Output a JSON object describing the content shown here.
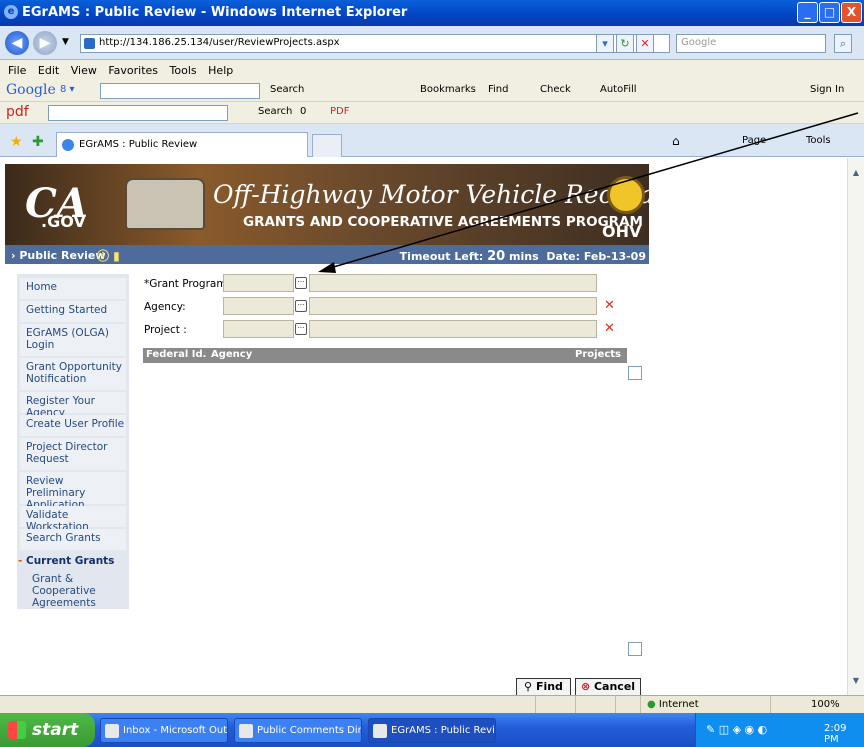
{
  "window": {
    "title": "EGrAMS : Public Review - Windows Internet Explorer",
    "buttons": [
      "_",
      "□",
      "X"
    ]
  },
  "address_bar": {
    "url": "http://134.186.25.134/user/ReviewProjects.aspx",
    "search_placeholder": "Google"
  },
  "menu": [
    "File",
    "Edit",
    "View",
    "Favorites",
    "Tools",
    "Help"
  ],
  "google_toolbar": {
    "logo": "Google",
    "g_label": "8 ▾",
    "search": "Search",
    "bookmarks": "Bookmarks",
    "find": "Find",
    "check": "Check",
    "autofill": "AutoFill",
    "signin": "Sign In"
  },
  "pdf_toolbar": {
    "logo": "pdf",
    "search": "Search",
    "count": "0",
    "pdf_label": "PDF"
  },
  "tab": {
    "title": "EGrAMS : Public Review",
    "page": "Page",
    "tools": "Tools"
  },
  "banner": {
    "ca": "CA",
    "gov": ".GOV",
    "title": "Off-Highway Motor Vehicle Recreation",
    "subtitle": "GRANTS AND COOPERATIVE AGREEMENTS PROGRAM",
    "ohv": "OHV"
  },
  "header_bar": {
    "left": "Public Review",
    "timeout_label": "Timeout Left:",
    "timeout_value": "20",
    "timeout_unit": "mins",
    "date": "Date: Feb-13-09"
  },
  "sidenav": [
    "Home",
    "Getting Started",
    "EGrAMS (OLGA) Login",
    "Grant Opportunity Notification",
    "Register Your Agency",
    "Create User Profile",
    "Project Director Request",
    "Review Preliminary Application",
    "Validate Workstation",
    "Search Grants"
  ],
  "current_grants": "Current Grants",
  "current_sub": "Grant & Cooperative Agreements",
  "form": {
    "grant_program": "*Grant Program:",
    "agency": "Agency:",
    "project": "Project :",
    "ellipsis": "···",
    "x": "✕"
  },
  "grid": {
    "col1": "Federal Id.",
    "col2": "Agency",
    "col3": "Projects"
  },
  "buttons": {
    "find": "Find",
    "cancel": "Cancel"
  },
  "status": {
    "zone": "Internet",
    "zoom": "100%"
  },
  "taskbar": {
    "start": "start",
    "tasks": [
      "Inbox - Microsoft Out...",
      "Public Comments Dire...",
      "EGrAMS : Public Revi..."
    ],
    "time": "2:09 PM"
  }
}
